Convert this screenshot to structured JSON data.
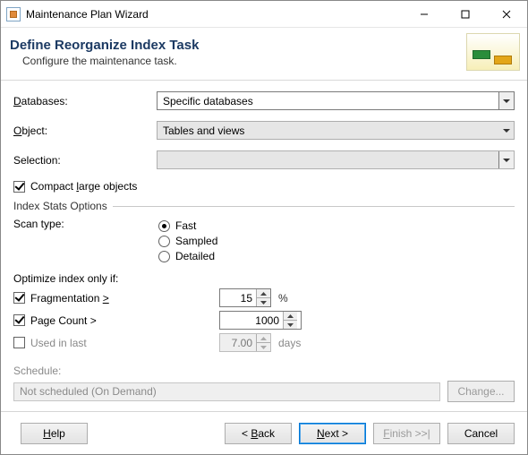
{
  "window": {
    "title": "Maintenance Plan Wizard"
  },
  "header": {
    "title": "Define Reorganize Index Task",
    "subtitle": "Configure the maintenance task."
  },
  "form": {
    "databases_label_pre": "",
    "databases_label_u": "D",
    "databases_label_post": "atabases:",
    "databases_value": "Specific databases",
    "object_label_pre": "",
    "object_label_u": "O",
    "object_label_post": "bject:",
    "object_value": "Tables and views",
    "selection_label": "Selection:",
    "selection_value": ""
  },
  "compact": {
    "pre": "Compact ",
    "u": "l",
    "post": "arge objects",
    "checked": true
  },
  "index_stats_heading": "Index Stats Options",
  "scan": {
    "label": "Scan type:",
    "options": {
      "fast": "Fast",
      "sampled": "Sampled",
      "detailed": "Detailed"
    },
    "selected": "fast"
  },
  "optimize": {
    "heading": "Optimize index only if:",
    "frag_label_pre": "Fragmentation ",
    "frag_label_u": ">",
    "frag_value": "15",
    "frag_unit": "%",
    "pagecount_label": "Page Count >",
    "pagecount_value": "1000",
    "used_label": "Used  in last",
    "used_value": "7.00",
    "used_unit": "days"
  },
  "schedule": {
    "label": "Schedule:",
    "value": "Not scheduled (On Demand)",
    "change_btn": "Change..."
  },
  "footer": {
    "help_u": "H",
    "help_post": "elp",
    "back_pre": "< ",
    "back_u": "B",
    "back_post": "ack",
    "next_u": "N",
    "next_post": "ext >",
    "finish_u": "F",
    "finish_post": "inish >>|",
    "cancel": "Cancel"
  }
}
